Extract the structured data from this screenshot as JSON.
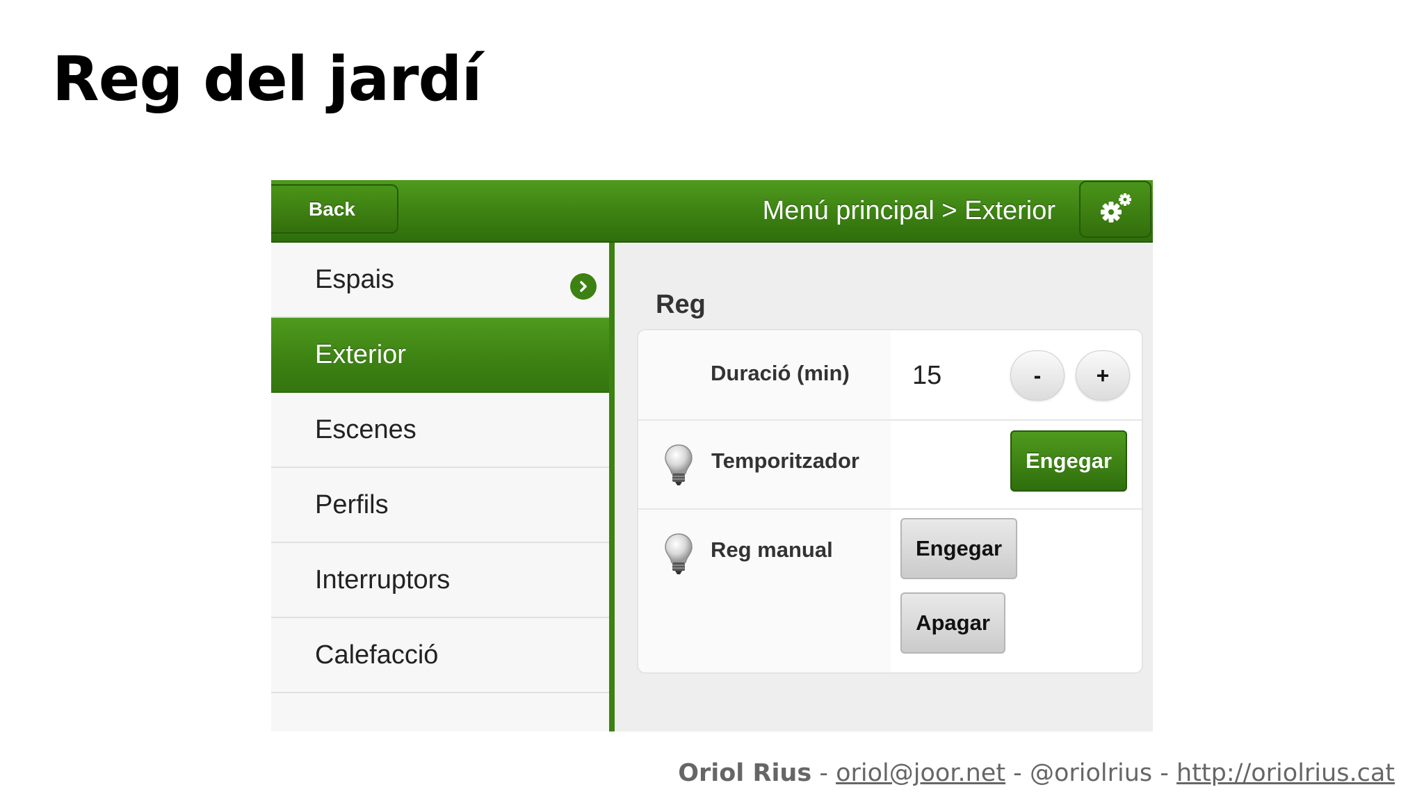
{
  "slide": {
    "title": "Reg del jardí"
  },
  "app": {
    "header": {
      "back_label": "Back",
      "breadcrumb": "Menú principal > Exterior",
      "settings_icon": "gears-icon"
    },
    "sidebar": {
      "items": [
        {
          "label": "Espais",
          "has_arrow": true
        },
        {
          "label": "Exterior",
          "active": true
        },
        {
          "label": "Escenes"
        },
        {
          "label": "Perfils"
        },
        {
          "label": "Interruptors"
        },
        {
          "label": "Calefacció"
        }
      ]
    },
    "content": {
      "section_title": "Reg",
      "rows": {
        "duration": {
          "label": "Duració (min)",
          "value": "15",
          "minus_label": "-",
          "plus_label": "+"
        },
        "timer": {
          "label": "Temporitzador",
          "icon": "lightbulb-icon",
          "button_label": "Engegar"
        },
        "manual": {
          "label": "Reg manual",
          "icon": "lightbulb-icon",
          "on_label": "Engegar",
          "off_label": "Apagar"
        }
      }
    },
    "colors": {
      "accent_green": "#3c8112",
      "panel_bg": "#eeeeee"
    }
  },
  "footer": {
    "name": "Oriol Rius",
    "sep1": " - ",
    "email": "oriol@joor.net",
    "sep2": " - ",
    "handle": "@oriolrius",
    "sep3": " - ",
    "url": "http://oriolrius.cat"
  }
}
